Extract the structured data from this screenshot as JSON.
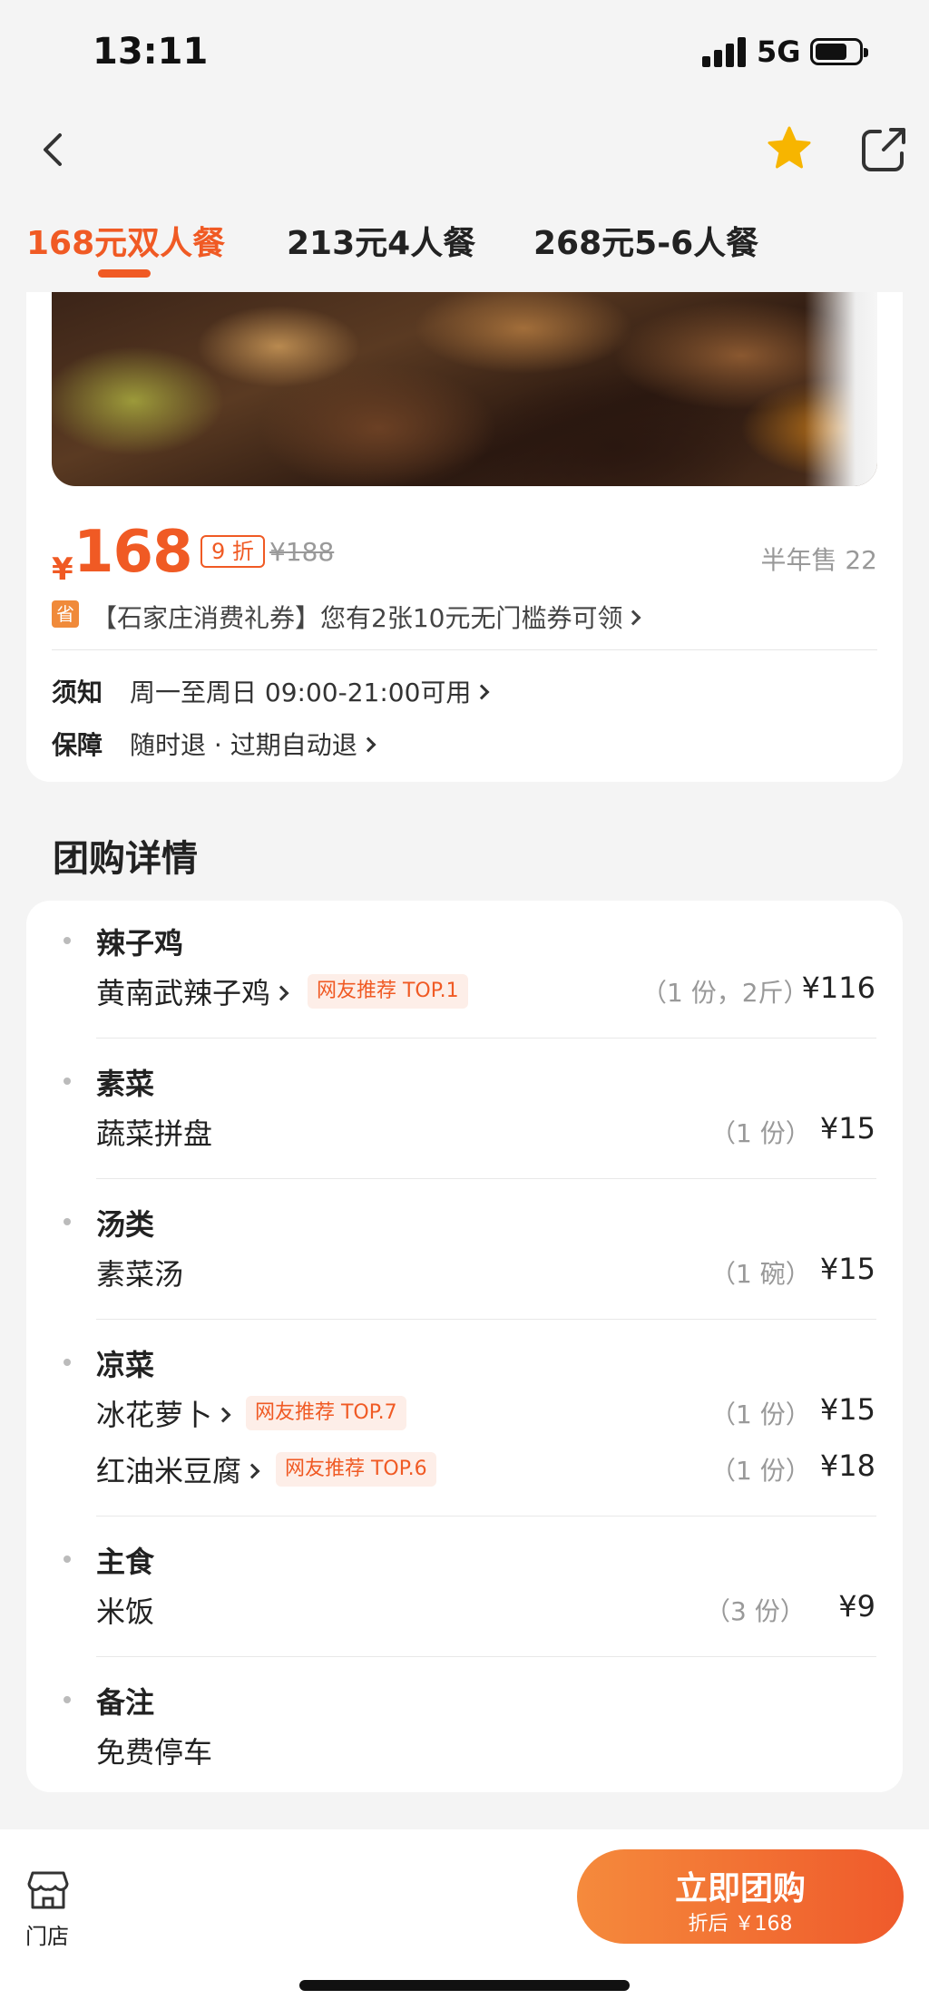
{
  "status_bar": {
    "time": "13:11",
    "network": "5G"
  },
  "nav": {
    "back_icon": "chevron-left-icon",
    "favorite_icon": "star-icon",
    "share_icon": "share-icon",
    "favorite_color": "#f7b500"
  },
  "tabs": [
    {
      "label": "168元双人餐",
      "active": true
    },
    {
      "label": "213元4人餐",
      "active": false
    },
    {
      "label": "268元5-6人餐",
      "active": false
    }
  ],
  "product": {
    "currency": "¥",
    "price": "168",
    "discount": "9 折",
    "original_price": "¥188",
    "sold": "半年售 22",
    "coupon_icon": "省",
    "coupon_text": "【石家庄消费礼券】您有2张10元无门槛券可领",
    "notice_label": "须知",
    "notice_value": "周一至周日 09:00-21:00可用",
    "guarantee_label": "保障",
    "guarantee_value": "随时退 · 过期自动退"
  },
  "details": {
    "title": "团购详情",
    "categories": [
      {
        "title": "辣子鸡",
        "items": [
          {
            "name": "黄南武辣子鸡",
            "tag": "网友推荐 TOP.1",
            "qty": "（1 份，2斤）",
            "price": "¥116"
          }
        ]
      },
      {
        "title": "素菜",
        "items": [
          {
            "name": "蔬菜拼盘",
            "qty": "（1 份）",
            "price": "¥15"
          }
        ]
      },
      {
        "title": "汤类",
        "items": [
          {
            "name": "素菜汤",
            "qty": "（1 碗）",
            "price": "¥15"
          }
        ]
      },
      {
        "title": "凉菜",
        "items": [
          {
            "name": "冰花萝卜",
            "tag": "网友推荐 TOP.7",
            "qty": "（1 份）",
            "price": "¥15"
          },
          {
            "name": "红油米豆腐",
            "tag": "网友推荐 TOP.6",
            "qty": "（1 份）",
            "price": "¥18"
          }
        ]
      },
      {
        "title": "主食",
        "items": [
          {
            "name": "米饭",
            "qty": "（3 份）",
            "price": "¥9"
          }
        ]
      },
      {
        "title": "备注",
        "items": [
          {
            "name": "免费停车"
          }
        ]
      }
    ]
  },
  "bottom": {
    "store_label": "门店",
    "store_icon": "store-icon",
    "buy_label": "立即团购",
    "buy_sub": "折后 ￥168"
  },
  "colors": {
    "accent": "#f05a24",
    "tag_bg": "#fdeee8",
    "page_bg": "#f4f4f4"
  }
}
